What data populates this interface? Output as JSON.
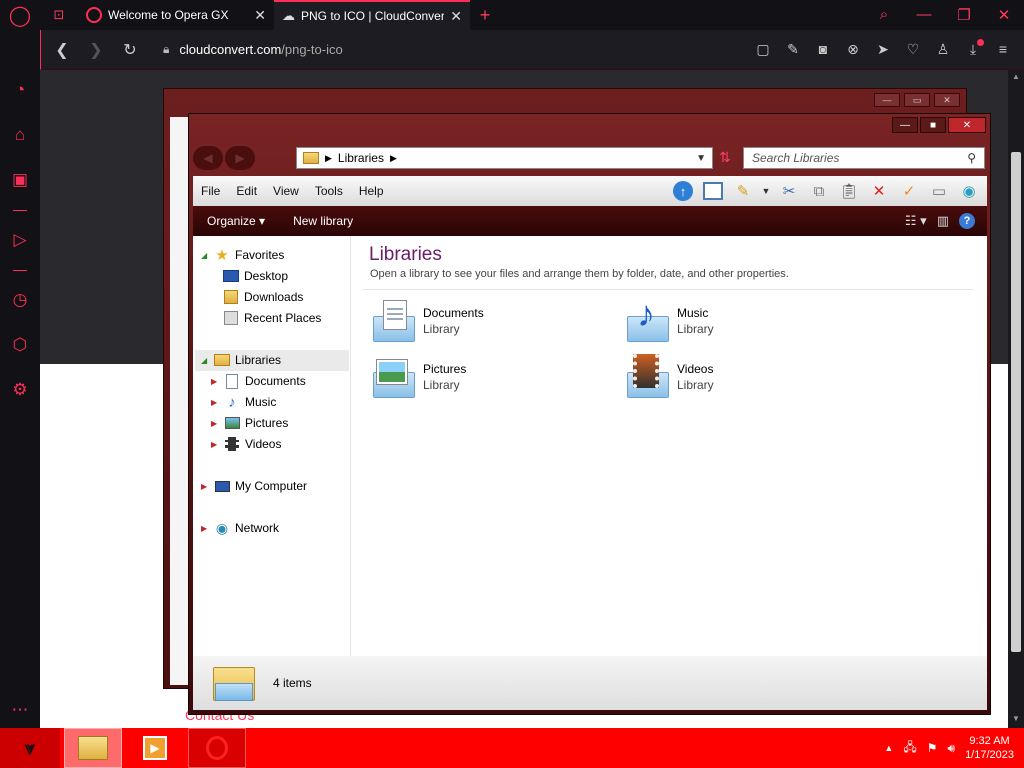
{
  "browser": {
    "tabs": [
      {
        "title": "Welcome to Opera GX"
      },
      {
        "title": "PNG to ICO | CloudConvert"
      }
    ],
    "url": {
      "domain": "cloudconvert.com",
      "path": "/png-to-ico"
    },
    "accent": "#ff2e56"
  },
  "webpage": {
    "contact": "Contact Us"
  },
  "explorer": {
    "address": "Libraries",
    "search_placeholder": "Search Libraries",
    "menu": [
      "File",
      "Edit",
      "View",
      "Tools",
      "Help"
    ],
    "commands": {
      "organize": "Organize",
      "new_library": "New library"
    },
    "nav": {
      "favorites": "Favorites",
      "desktop": "Desktop",
      "downloads": "Downloads",
      "recent": "Recent Places",
      "libraries": "Libraries",
      "documents": "Documents",
      "music": "Music",
      "pictures": "Pictures",
      "videos": "Videos",
      "computer": "My Computer",
      "network": "Network"
    },
    "main": {
      "title": "Libraries",
      "subtitle": "Open a library to see your files and arrange them by folder, date, and other properties.",
      "libraries": [
        {
          "name": "Documents",
          "type": "Library"
        },
        {
          "name": "Music",
          "type": "Library"
        },
        {
          "name": "Pictures",
          "type": "Library"
        },
        {
          "name": "Videos",
          "type": "Library"
        }
      ]
    },
    "status": "4 items"
  },
  "taskbar": {
    "time": "9:32 AM",
    "date": "1/17/2023",
    "color": "#ff0000"
  }
}
